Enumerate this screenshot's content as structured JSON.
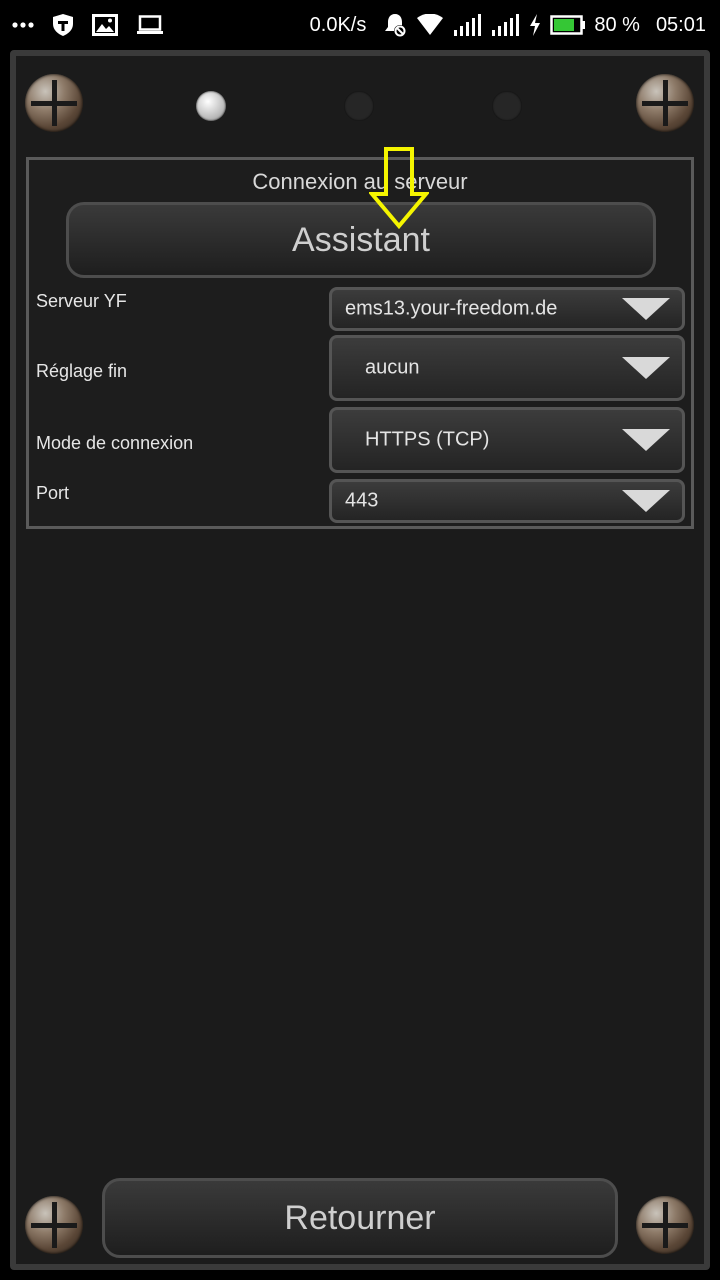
{
  "status_bar": {
    "net_speed": "0.0K/s",
    "battery_percent": "80 %",
    "time": "05:01",
    "battery_level": 0.8,
    "icons": [
      "more-icon",
      "shield-icon",
      "image-icon",
      "laptop-icon",
      "alarm-off-icon",
      "wifi-icon",
      "signal-icon",
      "signal-icon",
      "charging-icon",
      "battery-icon"
    ]
  },
  "pager": {
    "pages": 3,
    "active_index": 0
  },
  "panel": {
    "title": "Connexion au serveur",
    "assistant_label": "Assistant",
    "fields": [
      {
        "label": "Serveur YF",
        "value": "ems13.your-freedom.de"
      },
      {
        "label": "Réglage fin",
        "value": "aucun"
      },
      {
        "label": "Mode de connexion",
        "value": "HTTPS (TCP)"
      },
      {
        "label": "Port",
        "value": "443"
      }
    ]
  },
  "footer": {
    "back_label": "Retourner"
  },
  "colors": {
    "arrow": "#f5f500",
    "background": "#1b1b1b"
  }
}
